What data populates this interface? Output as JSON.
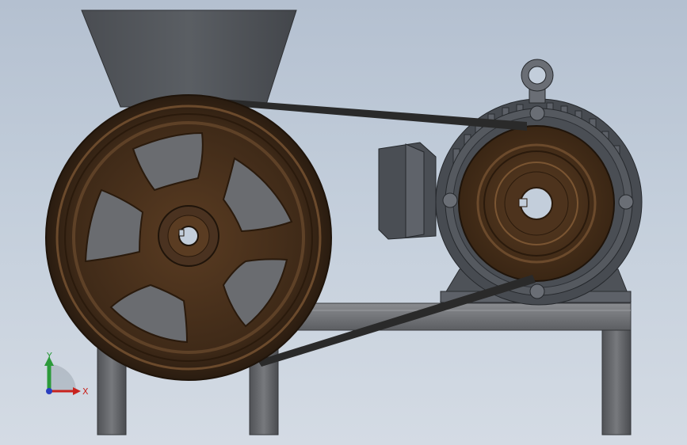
{
  "viewport": {
    "background_top": "#b4c0d0",
    "background_bottom": "#d4dbe4"
  },
  "model": {
    "hopper_color": "#505458",
    "pulley_color": "#4a3220",
    "pulley_rim_color": "#6b4a2c",
    "belt_color": "#2a2a2a",
    "frame_color": "#6e7074",
    "motor_color": "#55595f",
    "mount_color": "#3e5f8a"
  },
  "triad": {
    "y_label": "Y",
    "x_label": "X",
    "y_color": "#2c9a3a",
    "x_color": "#c8231e",
    "z_color": "#2a3fc0"
  }
}
